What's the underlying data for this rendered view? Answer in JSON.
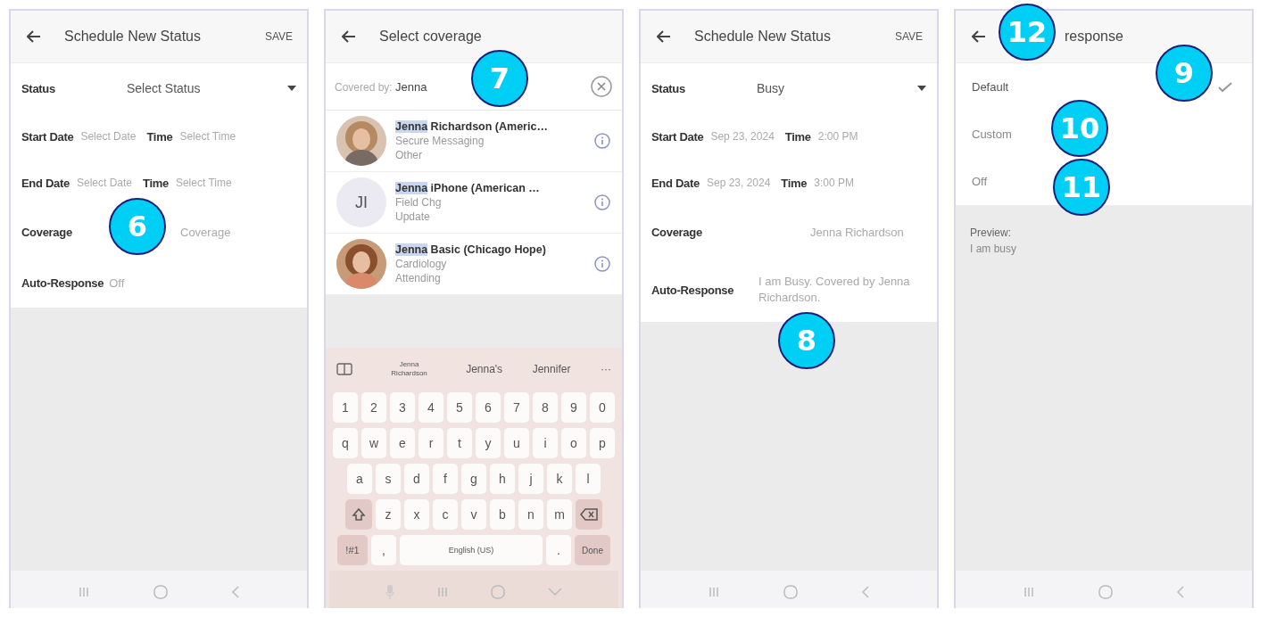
{
  "screens": [
    {
      "kind": "form",
      "title": "Schedule New Status",
      "action": "SAVE",
      "rows": [
        {
          "kind": "select",
          "label": "Status",
          "value": "Select Status"
        },
        {
          "kind": "datetime",
          "date_label": "Start Date",
          "date_value": "Select Date",
          "time_label": "Time",
          "time_value": "Select Time"
        },
        {
          "kind": "datetime",
          "date_label": "End Date",
          "date_value": "Select Date",
          "time_label": "Time",
          "time_value": "Select Time"
        },
        {
          "kind": "text",
          "label": "Coverage",
          "value": "Coverage",
          "callout": "6"
        },
        {
          "kind": "inline",
          "label": "Auto-Response",
          "value": "Off"
        }
      ]
    },
    {
      "kind": "search",
      "title": "Select coverage",
      "search": {
        "prefix": "Covered by:",
        "value": "Jenna",
        "callout": "7"
      },
      "contacts": [
        {
          "match": "Jenna",
          "name": " Richardson (Americ…",
          "line1": "Secure Messaging",
          "line2": "Other"
        },
        {
          "kind": "initials",
          "initials": "JI",
          "match": "Jenna",
          "name": " iPhone (American …",
          "line1": "Field Chg",
          "line2": "Update"
        },
        {
          "match": "Jenna",
          "name": " Basic (Chicago Hope)",
          "line1": "Cardiology",
          "line2": "Attending"
        }
      ],
      "keyboard": {
        "suggestions": [
          "Jenna Richardson",
          "Jenna's",
          "Jennifer"
        ],
        "more": "···",
        "rows": [
          [
            "1",
            "2",
            "3",
            "4",
            "5",
            "6",
            "7",
            "8",
            "9",
            "0"
          ],
          [
            "q",
            "w",
            "e",
            "r",
            "t",
            "y",
            "u",
            "i",
            "o",
            "p"
          ],
          [
            "a",
            "s",
            "d",
            "f",
            "g",
            "h",
            "j",
            "k",
            "l"
          ],
          [
            "z",
            "x",
            "c",
            "v",
            "b",
            "n",
            "m"
          ]
        ],
        "symbols": "!#1",
        "comma": ",",
        "space": "English (US)",
        "period": ".",
        "action": "Done"
      }
    },
    {
      "kind": "form",
      "title": "Schedule New Status",
      "action": "SAVE",
      "rows": [
        {
          "kind": "select",
          "label": "Status",
          "value": "Busy"
        },
        {
          "kind": "datetime",
          "date_label": "Start Date",
          "date_value": "Sep 23, 2024",
          "time_label": "Time",
          "time_value": "2:00 PM"
        },
        {
          "kind": "datetime",
          "date_label": "End Date",
          "date_value": "Sep 23, 2024",
          "time_label": "Time",
          "time_value": "3:00 PM"
        },
        {
          "kind": "text",
          "label": "Coverage",
          "value": "Jenna Richardson"
        },
        {
          "kind": "text",
          "label": "Auto-Response",
          "value": "I am Busy. Covered by Jenna Richardson.",
          "callout": "8"
        }
      ]
    },
    {
      "kind": "options",
      "title": "response",
      "title_callout": "12",
      "options": [
        {
          "label": "Default",
          "selected": true,
          "callout": "9"
        },
        {
          "label": "Custom",
          "selected": false,
          "callout": "10"
        },
        {
          "label": "Off",
          "selected": false,
          "callout": "11"
        }
      ],
      "preview_label": "Preview:",
      "preview_text": "I am busy"
    }
  ]
}
